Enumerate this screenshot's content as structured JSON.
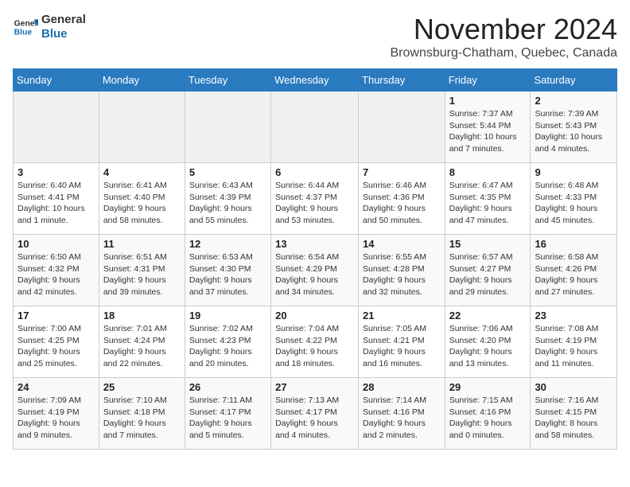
{
  "logo": {
    "line1": "General",
    "line2": "Blue"
  },
  "title": "November 2024",
  "location": "Brownsburg-Chatham, Quebec, Canada",
  "days_of_week": [
    "Sunday",
    "Monday",
    "Tuesday",
    "Wednesday",
    "Thursday",
    "Friday",
    "Saturday"
  ],
  "weeks": [
    [
      {
        "day": "",
        "info": ""
      },
      {
        "day": "",
        "info": ""
      },
      {
        "day": "",
        "info": ""
      },
      {
        "day": "",
        "info": ""
      },
      {
        "day": "",
        "info": ""
      },
      {
        "day": "1",
        "info": "Sunrise: 7:37 AM\nSunset: 5:44 PM\nDaylight: 10 hours and 7 minutes."
      },
      {
        "day": "2",
        "info": "Sunrise: 7:39 AM\nSunset: 5:43 PM\nDaylight: 10 hours and 4 minutes."
      }
    ],
    [
      {
        "day": "3",
        "info": "Sunrise: 6:40 AM\nSunset: 4:41 PM\nDaylight: 10 hours and 1 minute."
      },
      {
        "day": "4",
        "info": "Sunrise: 6:41 AM\nSunset: 4:40 PM\nDaylight: 9 hours and 58 minutes."
      },
      {
        "day": "5",
        "info": "Sunrise: 6:43 AM\nSunset: 4:39 PM\nDaylight: 9 hours and 55 minutes."
      },
      {
        "day": "6",
        "info": "Sunrise: 6:44 AM\nSunset: 4:37 PM\nDaylight: 9 hours and 53 minutes."
      },
      {
        "day": "7",
        "info": "Sunrise: 6:46 AM\nSunset: 4:36 PM\nDaylight: 9 hours and 50 minutes."
      },
      {
        "day": "8",
        "info": "Sunrise: 6:47 AM\nSunset: 4:35 PM\nDaylight: 9 hours and 47 minutes."
      },
      {
        "day": "9",
        "info": "Sunrise: 6:48 AM\nSunset: 4:33 PM\nDaylight: 9 hours and 45 minutes."
      }
    ],
    [
      {
        "day": "10",
        "info": "Sunrise: 6:50 AM\nSunset: 4:32 PM\nDaylight: 9 hours and 42 minutes."
      },
      {
        "day": "11",
        "info": "Sunrise: 6:51 AM\nSunset: 4:31 PM\nDaylight: 9 hours and 39 minutes."
      },
      {
        "day": "12",
        "info": "Sunrise: 6:53 AM\nSunset: 4:30 PM\nDaylight: 9 hours and 37 minutes."
      },
      {
        "day": "13",
        "info": "Sunrise: 6:54 AM\nSunset: 4:29 PM\nDaylight: 9 hours and 34 minutes."
      },
      {
        "day": "14",
        "info": "Sunrise: 6:55 AM\nSunset: 4:28 PM\nDaylight: 9 hours and 32 minutes."
      },
      {
        "day": "15",
        "info": "Sunrise: 6:57 AM\nSunset: 4:27 PM\nDaylight: 9 hours and 29 minutes."
      },
      {
        "day": "16",
        "info": "Sunrise: 6:58 AM\nSunset: 4:26 PM\nDaylight: 9 hours and 27 minutes."
      }
    ],
    [
      {
        "day": "17",
        "info": "Sunrise: 7:00 AM\nSunset: 4:25 PM\nDaylight: 9 hours and 25 minutes."
      },
      {
        "day": "18",
        "info": "Sunrise: 7:01 AM\nSunset: 4:24 PM\nDaylight: 9 hours and 22 minutes."
      },
      {
        "day": "19",
        "info": "Sunrise: 7:02 AM\nSunset: 4:23 PM\nDaylight: 9 hours and 20 minutes."
      },
      {
        "day": "20",
        "info": "Sunrise: 7:04 AM\nSunset: 4:22 PM\nDaylight: 9 hours and 18 minutes."
      },
      {
        "day": "21",
        "info": "Sunrise: 7:05 AM\nSunset: 4:21 PM\nDaylight: 9 hours and 16 minutes."
      },
      {
        "day": "22",
        "info": "Sunrise: 7:06 AM\nSunset: 4:20 PM\nDaylight: 9 hours and 13 minutes."
      },
      {
        "day": "23",
        "info": "Sunrise: 7:08 AM\nSunset: 4:19 PM\nDaylight: 9 hours and 11 minutes."
      }
    ],
    [
      {
        "day": "24",
        "info": "Sunrise: 7:09 AM\nSunset: 4:19 PM\nDaylight: 9 hours and 9 minutes."
      },
      {
        "day": "25",
        "info": "Sunrise: 7:10 AM\nSunset: 4:18 PM\nDaylight: 9 hours and 7 minutes."
      },
      {
        "day": "26",
        "info": "Sunrise: 7:11 AM\nSunset: 4:17 PM\nDaylight: 9 hours and 5 minutes."
      },
      {
        "day": "27",
        "info": "Sunrise: 7:13 AM\nSunset: 4:17 PM\nDaylight: 9 hours and 4 minutes."
      },
      {
        "day": "28",
        "info": "Sunrise: 7:14 AM\nSunset: 4:16 PM\nDaylight: 9 hours and 2 minutes."
      },
      {
        "day": "29",
        "info": "Sunrise: 7:15 AM\nSunset: 4:16 PM\nDaylight: 9 hours and 0 minutes."
      },
      {
        "day": "30",
        "info": "Sunrise: 7:16 AM\nSunset: 4:15 PM\nDaylight: 8 hours and 58 minutes."
      }
    ]
  ]
}
